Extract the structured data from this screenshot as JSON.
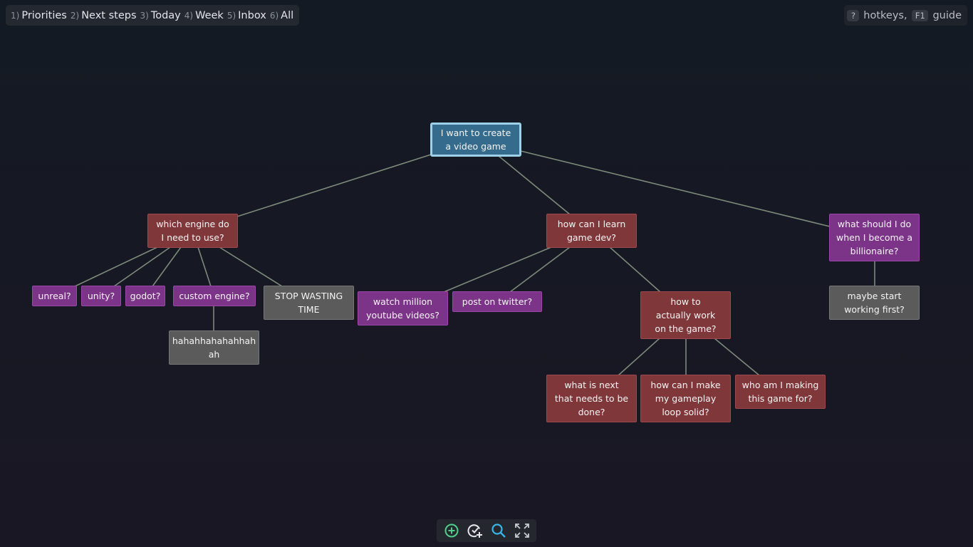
{
  "nav": {
    "items": [
      {
        "num": "1)",
        "label": "Priorities"
      },
      {
        "num": "2)",
        "label": "Next steps"
      },
      {
        "num": "3)",
        "label": "Today"
      },
      {
        "num": "4)",
        "label": "Week"
      },
      {
        "num": "5)",
        "label": "Inbox"
      },
      {
        "num": "6)",
        "label": "All"
      }
    ]
  },
  "help": {
    "key1": "?",
    "text1": "hotkeys,",
    "key2": "F1",
    "text2": "guide"
  },
  "nodes": {
    "root": "I want to create a video game",
    "engine": "which engine do I need to use?",
    "learn": "how can I learn game dev?",
    "billionaire": "what should I do when I become a billionaire?",
    "unreal": "unreal?",
    "unity": "unity?",
    "godot": "godot?",
    "custom": "custom engine?",
    "stop": "STOP WASTING TIME",
    "haha": "hahahhahahahhahah",
    "youtube": "watch million youtube videos?",
    "twitter": "post on twitter?",
    "work": "how to actually work on the game?",
    "next": "what is next that needs to be done?",
    "loop": "how can I make my gameplay loop solid?",
    "who": "who am I making this game for?",
    "startwork": "maybe start working first?"
  },
  "colors": {
    "red": "#80373a",
    "purple": "#7c3488",
    "gray": "#5b5b5b",
    "root": "#356b8c",
    "root_border": "#9fd0ea",
    "edge": "#7d8a7a",
    "add_icon": "#4fd08a",
    "search_icon": "#38b6e8"
  },
  "toolbar": {
    "icons": [
      "add-node-icon",
      "add-task-check-icon",
      "search-icon",
      "fullscreen-icon"
    ]
  }
}
